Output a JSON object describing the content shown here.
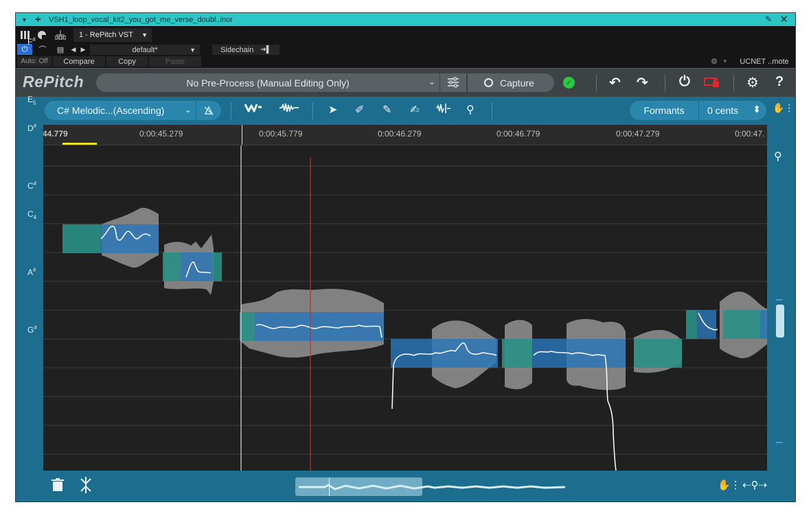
{
  "window": {
    "title": "VSH1_loop_vocal_kit2_you_got_me_verse_doubl..inor"
  },
  "host": {
    "plugin_selector": "1 - RePitch VST",
    "preset": "default*",
    "sidechain_label": "Sidechain",
    "auto_label": "Auto: Off",
    "compare_label": "Compare",
    "copy_label": "Copy",
    "paste_label": "Paste",
    "remote_label": "UCNET ..mote"
  },
  "plugin": {
    "logo": "RePitch",
    "preprocess": "No Pre-Process (Manual Editing Only)",
    "capture_label": "Capture"
  },
  "toolbar": {
    "scale": "C# Melodic...(Ascending)",
    "formants_label": "Formants",
    "cents_value": "0 cents"
  },
  "ruler": {
    "ticks": [
      "44.779",
      "0:00:45.279",
      "0:00:45.779",
      "0:00:46.279",
      "0:00:46.779",
      "0:00:47.279",
      "0:00:47."
    ]
  },
  "pitch_labels": [
    {
      "note": "F",
      "mod": "#",
      "kind": "sup"
    },
    {
      "note": "E",
      "mod": "5",
      "kind": "sub"
    },
    {
      "note": "D",
      "mod": "#",
      "kind": "sup"
    },
    {
      "note": "C",
      "mod": "#",
      "kind": "sup"
    },
    {
      "note": "C",
      "mod": "4",
      "kind": "sub"
    },
    {
      "note": "A",
      "mod": "#",
      "kind": "sup"
    },
    {
      "note": "G",
      "mod": "#",
      "kind": "sup"
    }
  ],
  "colors": {
    "accent": "#1d6d8f",
    "note_blue": "#2a76b8",
    "note_teal": "#2a8f86",
    "playhead": "#d22a2a",
    "title_bar": "#2bc7c7"
  }
}
